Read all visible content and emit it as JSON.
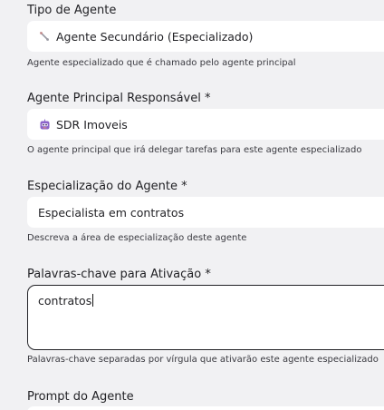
{
  "agent_type": {
    "label": "Tipo de Agente",
    "value": "Agente Secundário (Especializado)",
    "icon": "branch-icon",
    "help": "Agente especializado que é chamado pelo agente principal"
  },
  "principal_agent": {
    "label": "Agente Principal Responsável *",
    "value": "SDR Imoveis",
    "icon": "robot-avatar-icon",
    "help": "O agente principal que irá delegar tarefas para este agente especializado"
  },
  "specialization": {
    "label": "Especialização do Agente *",
    "value": "Especialista em contratos",
    "help": "Descreva a área de especialização deste agente"
  },
  "keywords": {
    "label": "Palavras-chave para Ativação *",
    "value": "contratos",
    "help": "Palavras-chave separadas por vírgula que ativarão este agente especializado"
  },
  "prompt": {
    "label": "Prompt do Agente"
  }
}
